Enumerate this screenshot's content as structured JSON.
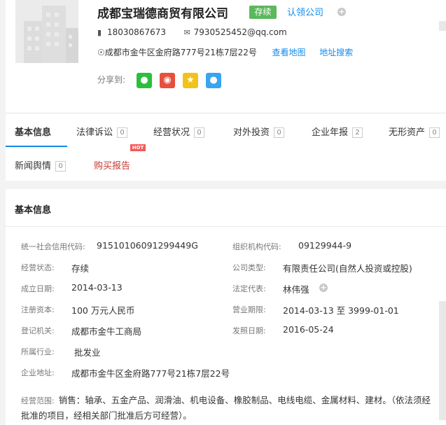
{
  "company": {
    "name": "成都宝瑞德商贸有限公司",
    "status_badge": "存续",
    "claim_link": "认领公司",
    "phone": "18030867673",
    "email": "7930525452@qq.com",
    "address": "成都市金牛区金府路777号21栋7层22号",
    "view_map": "查看地图",
    "address_search": "地址搜索",
    "share_label": "分享到:"
  },
  "tabs": [
    {
      "label": "基本信息",
      "count": ""
    },
    {
      "label": "法律诉讼",
      "count": "0"
    },
    {
      "label": "经营状况",
      "count": "0"
    },
    {
      "label": "对外投资",
      "count": "0"
    },
    {
      "label": "企业年报",
      "count": "2"
    },
    {
      "label": "无形资产",
      "count": "0"
    },
    {
      "label": "新闻舆情",
      "count": "0"
    },
    {
      "label": "购买报告",
      "count": ""
    }
  ],
  "hot_badge": "HOT",
  "basic_info": {
    "title": "基本信息",
    "fields": [
      {
        "label": "统一社会信用代码:",
        "value": "91510106091299449G"
      },
      {
        "label": "组织机构代码:",
        "value": "09129944-9"
      },
      {
        "label": "经营状态:",
        "value": "存续"
      },
      {
        "label": "公司类型:",
        "value": "有限责任公司(自然人投资或控股)"
      },
      {
        "label": "成立日期:",
        "value": "2014-03-13"
      },
      {
        "label": "法定代表:",
        "value": "林伟强"
      },
      {
        "label": "注册资本:",
        "value": "100 万元人民币"
      },
      {
        "label": "营业期限:",
        "value": "2014-03-13 至 3999-01-01"
      },
      {
        "label": "登记机关:",
        "value": "成都市金牛工商局"
      },
      {
        "label": "发照日期:",
        "value": "2016-05-24"
      },
      {
        "label": "所属行业:",
        "value": "批发业"
      },
      {
        "label": "企业地址:",
        "value": "成都市金牛区金府路777号21栋7层22号"
      }
    ],
    "scope_label": "经营范围:",
    "scope_text": "销售：轴承、五金产品、润滑油、机电设备、橡胶制品、电线电缆、金属材料、建材。（依法须经批准的项目，经相关部门批准后方可经营）。"
  },
  "colors": {
    "accent": "#128bed",
    "status_green": "#5cb85c",
    "report_red": "#c8372d"
  }
}
